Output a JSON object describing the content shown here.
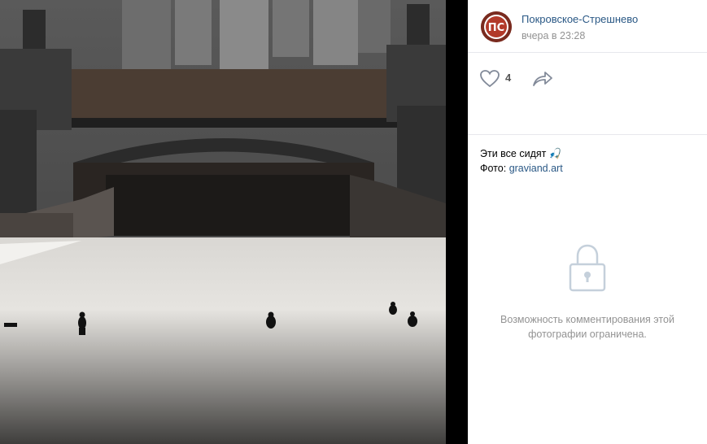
{
  "post": {
    "author_name": "Покровское-Стрешнево",
    "date": "вчера в 23:28",
    "avatar_text": "ПС"
  },
  "actions": {
    "like_count": "4",
    "like_icon": "heart-icon",
    "share_icon": "share-arrow-icon"
  },
  "caption": {
    "text": "Эти все сидят",
    "emoji": "🎣",
    "photo_label": "Фото:",
    "photo_link": "graviand.art"
  },
  "comments": {
    "lock_icon": "lock-icon",
    "locked_message": "Возможность комментирования этой фотографии ограничена."
  },
  "colors": {
    "link": "#2a5885",
    "muted": "#939393",
    "divider": "#e7e8ec"
  }
}
